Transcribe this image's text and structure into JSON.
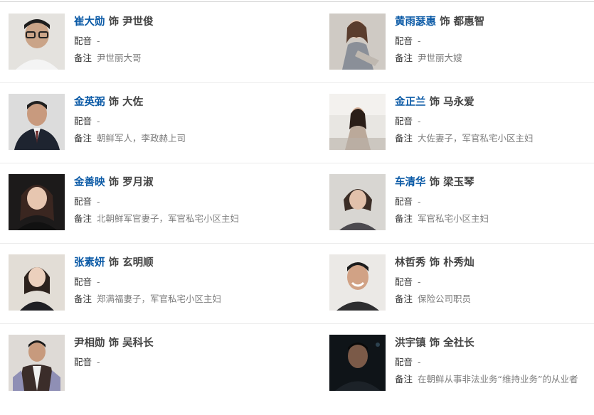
{
  "cast": [
    {
      "actor": "崔大勋",
      "actor_linked": true,
      "joiner": "饰",
      "role": "尹世俊",
      "dub_label": "配音",
      "dub_value": "-",
      "note_label": "备注",
      "note_value": "尹世丽大哥",
      "photo": "actor-photo-man-glasses"
    },
    {
      "actor": "黄雨瑟惠",
      "actor_linked": true,
      "joiner": "饰",
      "role": "都惠智",
      "dub_label": "配音",
      "dub_value": "-",
      "note_label": "备注",
      "note_value": "尹世丽大嫂",
      "photo": "actor-photo-woman-seated"
    },
    {
      "actor": "金英弼",
      "actor_linked": true,
      "joiner": "饰",
      "role": "大佐",
      "dub_label": "配音",
      "dub_value": "-",
      "note_label": "备注",
      "note_value": "朝鲜军人，李政赫上司",
      "photo": "actor-photo-man-suit"
    },
    {
      "actor": "金正兰",
      "actor_linked": true,
      "joiner": "饰",
      "role": "马永爱",
      "dub_label": "配音",
      "dub_value": "-",
      "note_label": "备注",
      "note_value": "大佐妻子，军官私宅小区主妇",
      "photo": "actor-photo-woman-outdoor"
    },
    {
      "actor": "金善映",
      "actor_linked": true,
      "joiner": "饰",
      "role": "罗月淑",
      "dub_label": "配音",
      "dub_value": "-",
      "note_label": "备注",
      "note_value": "北朝鲜军官妻子，军官私宅小区主妇",
      "photo": "actor-photo-woman-dark"
    },
    {
      "actor": "车清华",
      "actor_linked": true,
      "joiner": "饰",
      "role": "梁玉琴",
      "dub_label": "配音",
      "dub_value": "-",
      "note_label": "备注",
      "note_value": "军官私宅小区主妇",
      "photo": "actor-photo-woman-short-hair"
    },
    {
      "actor": "张素妍",
      "actor_linked": true,
      "joiner": "饰",
      "role": "玄明顺",
      "dub_label": "配音",
      "dub_value": "-",
      "note_label": "备注",
      "note_value": "郑满福妻子，军官私宅小区主妇",
      "photo": "actor-photo-woman-smiling"
    },
    {
      "actor": "林哲秀",
      "actor_linked": false,
      "joiner": "饰",
      "role": "朴秀灿",
      "dub_label": "配音",
      "dub_value": "-",
      "note_label": "备注",
      "note_value": "保险公司职员",
      "photo": "actor-photo-man-smiling"
    },
    {
      "actor": "尹相勋",
      "actor_linked": false,
      "joiner": "饰",
      "role": "吴科长",
      "dub_label": "配音",
      "dub_value": "-",
      "note_label": "",
      "note_value": "",
      "photo": "actor-photo-man-vest"
    },
    {
      "actor": "洪宇镇",
      "actor_linked": false,
      "joiner": "饰",
      "role": "全社长",
      "dub_label": "配音",
      "dub_value": "-",
      "note_label": "备注",
      "note_value": "在朝鲜从事非法业务“维持业务”的从业者",
      "photo": "actor-photo-man-night"
    }
  ],
  "colors": {
    "link": "#0b5aa6",
    "label": "#333333",
    "value": "#7d7d7d",
    "divider": "#ececec"
  }
}
